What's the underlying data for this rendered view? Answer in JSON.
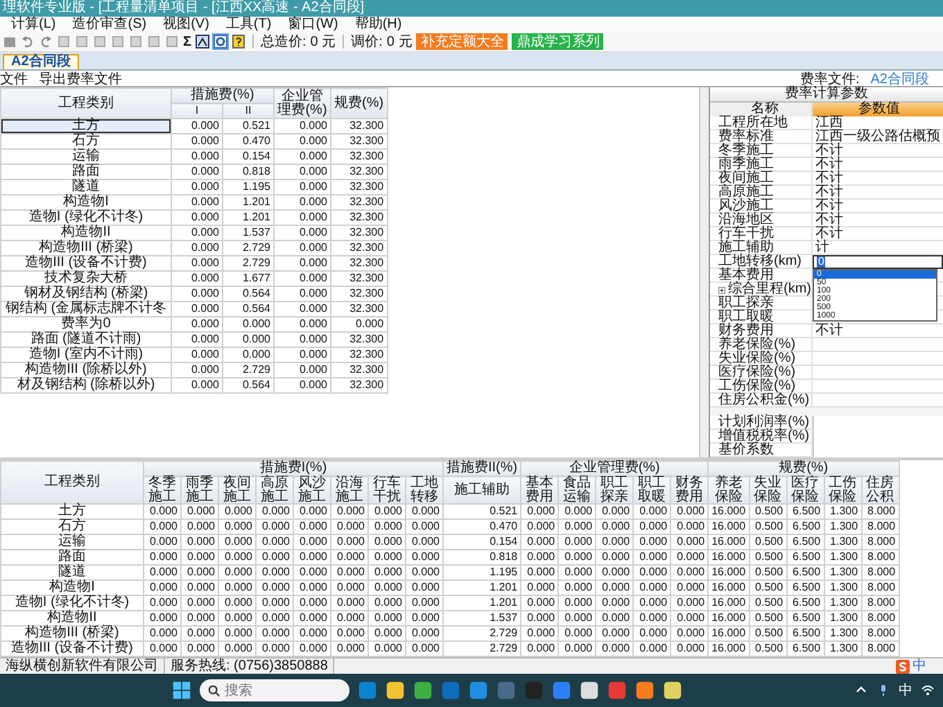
{
  "window": {
    "title": "理软件专业版 - [工程量清单项目 - [江西XX高速 - A2合同段]"
  },
  "menu": [
    "计算(L)",
    "造价审查(S)",
    "视图(V)",
    "工具(T)",
    "窗口(W)",
    "帮助(H)"
  ],
  "toolbar": {
    "sigma": "Σ",
    "total_label": "总造价:",
    "total_value": "0 元",
    "adjust_label": "调价:",
    "adjust_value": "0 元",
    "buttons": [
      {
        "label": "补充定额大全",
        "color": "#f47c20"
      },
      {
        "label": "鼎成学习系列",
        "color": "#27b24a"
      }
    ]
  },
  "tabs": [
    {
      "label": "A2合同段",
      "selected": true
    }
  ],
  "subbar": {
    "items": [
      "文件",
      "导出费率文件"
    ],
    "rate_file_label": "费率文件:",
    "rate_file_value": "A2合同段"
  },
  "rate_table": {
    "category_header": "工程类别",
    "group_header": "措施费(%)",
    "sub_headers": [
      "I",
      "II"
    ],
    "mgmt_header": "企业管理费(%)",
    "fee_header": "规费(%)",
    "rows": [
      {
        "category": "土方",
        "values": [
          "0.000",
          "0.521",
          "0.000",
          "32.300"
        ],
        "selected": true
      },
      {
        "category": "石方",
        "values": [
          "0.000",
          "0.470",
          "0.000",
          "32.300"
        ],
        "selected": false
      },
      {
        "category": "运输",
        "values": [
          "0.000",
          "0.154",
          "0.000",
          "32.300"
        ],
        "selected": false
      },
      {
        "category": "路面",
        "values": [
          "0.000",
          "0.818",
          "0.000",
          "32.300"
        ],
        "selected": false
      },
      {
        "category": "隧道",
        "values": [
          "0.000",
          "1.195",
          "0.000",
          "32.300"
        ],
        "selected": false
      },
      {
        "category": "构造物I",
        "values": [
          "0.000",
          "1.201",
          "0.000",
          "32.300"
        ],
        "selected": false
      },
      {
        "category": "造物I (绿化不计冬)",
        "values": [
          "0.000",
          "1.201",
          "0.000",
          "32.300"
        ],
        "selected": false
      },
      {
        "category": "构造物II",
        "values": [
          "0.000",
          "1.537",
          "0.000",
          "32.300"
        ],
        "selected": false
      },
      {
        "category": "构造物III (桥梁)",
        "values": [
          "0.000",
          "2.729",
          "0.000",
          "32.300"
        ],
        "selected": false
      },
      {
        "category": "造物III (设备不计费)",
        "values": [
          "0.000",
          "2.729",
          "0.000",
          "32.300"
        ],
        "selected": false
      },
      {
        "category": "技术复杂大桥",
        "values": [
          "0.000",
          "1.677",
          "0.000",
          "32.300"
        ],
        "selected": false
      },
      {
        "category": "钢材及钢结构 (桥梁)",
        "values": [
          "0.000",
          "0.564",
          "0.000",
          "32.300"
        ],
        "selected": false
      },
      {
        "category": "钢结构 (金属标志牌不计冬",
        "values": [
          "0.000",
          "0.564",
          "0.000",
          "32.300"
        ],
        "selected": false
      },
      {
        "category": "费率为0",
        "values": [
          "0.000",
          "0.000",
          "0.000",
          "0.000"
        ],
        "selected": false
      },
      {
        "category": "路面 (隧道不计雨)",
        "values": [
          "0.000",
          "0.000",
          "0.000",
          "32.300"
        ],
        "selected": false
      },
      {
        "category": "造物I (室内不计雨)",
        "values": [
          "0.000",
          "0.000",
          "0.000",
          "32.300"
        ],
        "selected": false
      },
      {
        "category": "构造物III (除桥以外)",
        "values": [
          "0.000",
          "2.729",
          "0.000",
          "32.300"
        ],
        "selected": false
      },
      {
        "category": "材及钢结构 (除桥以外)",
        "values": [
          "0.000",
          "0.564",
          "0.000",
          "32.300"
        ],
        "selected": false
      }
    ]
  },
  "params": {
    "title": "费率计算参数",
    "columns": [
      "名称",
      "参数值"
    ],
    "rows": [
      {
        "kind": "text",
        "name": "工程所在地",
        "value": "江西"
      },
      {
        "kind": "text",
        "name": "费率标准",
        "value": "江西一级公路估概预"
      },
      {
        "kind": "text",
        "name": "冬季施工",
        "value": "不计"
      },
      {
        "kind": "text",
        "name": "雨季施工",
        "value": "不计"
      },
      {
        "kind": "text",
        "name": "夜间施工",
        "value": "不计"
      },
      {
        "kind": "text",
        "name": "高原施工",
        "value": "不计"
      },
      {
        "kind": "text",
        "name": "风沙施工",
        "value": "不计"
      },
      {
        "kind": "text",
        "name": "沿海地区",
        "value": "不计"
      },
      {
        "kind": "text",
        "name": "行车干扰",
        "value": "不计"
      },
      {
        "kind": "text",
        "name": "施工辅助",
        "value": "计"
      },
      {
        "kind": "dropdown",
        "name": "工地转移(km)",
        "value": "0",
        "options": [
          {
            "label": "0",
            "selected": true
          },
          {
            "label": "50",
            "selected": false
          },
          {
            "label": "100",
            "selected": false
          },
          {
            "label": "200",
            "selected": false
          },
          {
            "label": "500",
            "selected": false
          },
          {
            "label": "1000",
            "selected": false
          }
        ]
      },
      {
        "kind": "text",
        "name": "基本费用"
      },
      {
        "kind": "group",
        "name": "综合里程(km)",
        "expanded": false
      },
      {
        "kind": "text",
        "name": "职工探亲"
      },
      {
        "kind": "text",
        "name": "职工取暖"
      },
      {
        "kind": "text",
        "name": "财务费用",
        "value": "不计"
      },
      {
        "kind": "text",
        "name": "养老保险(%)"
      },
      {
        "kind": "text",
        "name": "失业保险(%)"
      },
      {
        "kind": "text",
        "name": "医疗保险(%)"
      },
      {
        "kind": "text",
        "name": "工伤保险(%)"
      },
      {
        "kind": "text",
        "name": "住房公积金(%)"
      }
    ],
    "footer_rows": [
      "计划利润率(%)",
      "增值税税率(%)",
      "基价系数"
    ]
  },
  "detail_table": {
    "category_header": "工程类别",
    "groups": [
      {
        "label": "措施费I(%)",
        "columns": [
          "冬季施工",
          "雨季施工",
          "夜间施工",
          "高原施工",
          "风沙施工",
          "沿海施工",
          "行车干扰",
          "工地转移"
        ]
      },
      {
        "label": "措施费II(%)",
        "columns": [
          "施工辅助"
        ]
      },
      {
        "label": "企业管理费(%)",
        "columns": [
          "基本费用",
          "食品运输",
          "职工探亲",
          "职工取暖",
          "财务费用"
        ]
      },
      {
        "label": "规费(%)",
        "columns": [
          "养老保险",
          "失业保险",
          "医疗保险",
          "工伤保险",
          "住房公积"
        ]
      }
    ],
    "rows": [
      {
        "category": "土方",
        "values": [
          "0.000",
          "0.000",
          "0.000",
          "0.000",
          "0.000",
          "0.000",
          "0.000",
          "0.000",
          "0.521",
          "0.000",
          "0.000",
          "0.000",
          "0.000",
          "0.000",
          "16.000",
          "0.500",
          "6.500",
          "1.300",
          "8.000"
        ]
      },
      {
        "category": "石方",
        "values": [
          "0.000",
          "0.000",
          "0.000",
          "0.000",
          "0.000",
          "0.000",
          "0.000",
          "0.000",
          "0.470",
          "0.000",
          "0.000",
          "0.000",
          "0.000",
          "0.000",
          "16.000",
          "0.500",
          "6.500",
          "1.300",
          "8.000"
        ]
      },
      {
        "category": "运输",
        "values": [
          "0.000",
          "0.000",
          "0.000",
          "0.000",
          "0.000",
          "0.000",
          "0.000",
          "0.000",
          "0.154",
          "0.000",
          "0.000",
          "0.000",
          "0.000",
          "0.000",
          "16.000",
          "0.500",
          "6.500",
          "1.300",
          "8.000"
        ]
      },
      {
        "category": "路面",
        "values": [
          "0.000",
          "0.000",
          "0.000",
          "0.000",
          "0.000",
          "0.000",
          "0.000",
          "0.000",
          "0.818",
          "0.000",
          "0.000",
          "0.000",
          "0.000",
          "0.000",
          "16.000",
          "0.500",
          "6.500",
          "1.300",
          "8.000"
        ]
      },
      {
        "category": "隧道",
        "values": [
          "0.000",
          "0.000",
          "0.000",
          "0.000",
          "0.000",
          "0.000",
          "0.000",
          "0.000",
          "1.195",
          "0.000",
          "0.000",
          "0.000",
          "0.000",
          "0.000",
          "16.000",
          "0.500",
          "6.500",
          "1.300",
          "8.000"
        ]
      },
      {
        "category": "构造物I",
        "values": [
          "0.000",
          "0.000",
          "0.000",
          "0.000",
          "0.000",
          "0.000",
          "0.000",
          "0.000",
          "1.201",
          "0.000",
          "0.000",
          "0.000",
          "0.000",
          "0.000",
          "16.000",
          "0.500",
          "6.500",
          "1.300",
          "8.000"
        ]
      },
      {
        "category": "造物I (绿化不计冬)",
        "values": [
          "0.000",
          "0.000",
          "0.000",
          "0.000",
          "0.000",
          "0.000",
          "0.000",
          "0.000",
          "1.201",
          "0.000",
          "0.000",
          "0.000",
          "0.000",
          "0.000",
          "16.000",
          "0.500",
          "6.500",
          "1.300",
          "8.000"
        ]
      },
      {
        "category": "构造物II",
        "values": [
          "0.000",
          "0.000",
          "0.000",
          "0.000",
          "0.000",
          "0.000",
          "0.000",
          "0.000",
          "1.537",
          "0.000",
          "0.000",
          "0.000",
          "0.000",
          "0.000",
          "16.000",
          "0.500",
          "6.500",
          "1.300",
          "8.000"
        ]
      },
      {
        "category": "构造物III (桥梁)",
        "values": [
          "0.000",
          "0.000",
          "0.000",
          "0.000",
          "0.000",
          "0.000",
          "0.000",
          "0.000",
          "2.729",
          "0.000",
          "0.000",
          "0.000",
          "0.000",
          "0.000",
          "16.000",
          "0.500",
          "6.500",
          "1.300",
          "8.000"
        ]
      },
      {
        "category": "造物III (设备不计费)",
        "values": [
          "0.000",
          "0.000",
          "0.000",
          "0.000",
          "0.000",
          "0.000",
          "0.000",
          "0.000",
          "2.729",
          "0.000",
          "0.000",
          "0.000",
          "0.000",
          "0.000",
          "16.000",
          "0.500",
          "6.500",
          "1.300",
          "8.000"
        ]
      }
    ]
  },
  "status_bar": [
    "海纵横创新软件有限公司",
    "服务热线: (0756)3850888"
  ],
  "ime_indicator": "中",
  "taskbar": {
    "search_placeholder": "搜索",
    "tray_ime": "中"
  }
}
